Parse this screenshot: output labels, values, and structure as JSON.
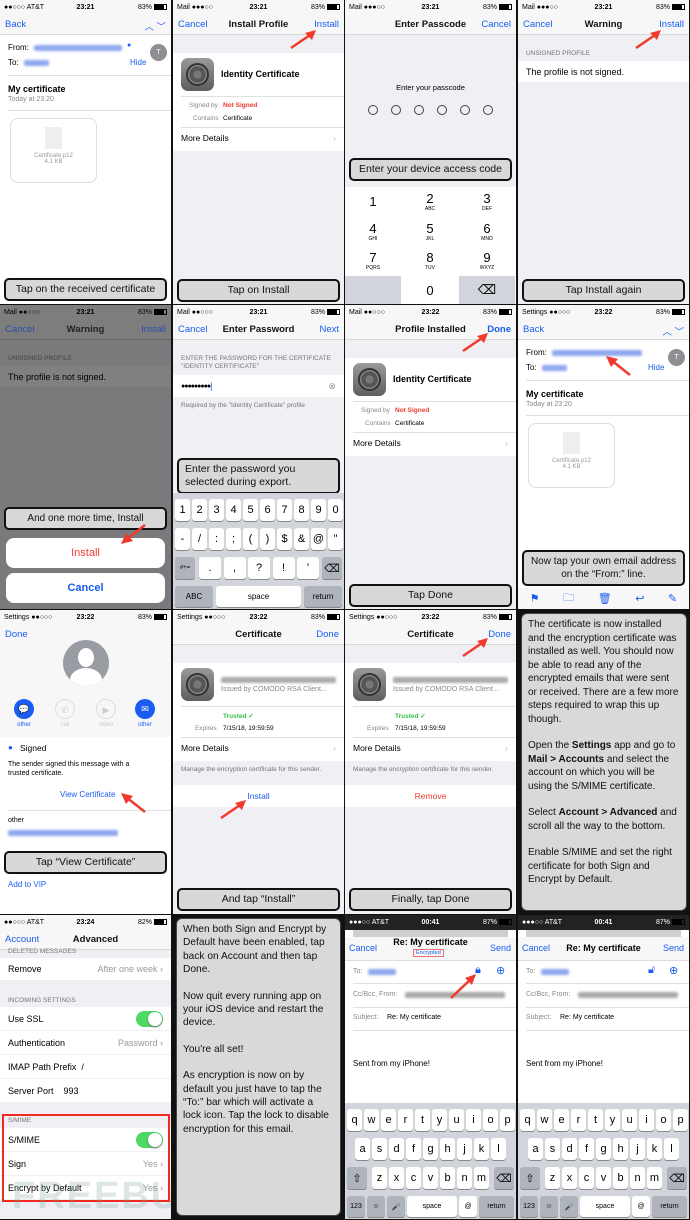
{
  "colors": {
    "accent": "#1a5df0",
    "warning": "#f03a2e",
    "caption_bg": "#d8d8d8",
    "toggle_on": "#4cd964",
    "trusted": "#35c048"
  },
  "watermark": "FREEBUF",
  "status": [
    {
      "left": "●●○○○ AT&T",
      "time": "23:21",
      "battery": "83%"
    },
    {
      "left": "Mail ●●●○○",
      "time": "23:21",
      "battery": "83%"
    },
    {
      "left": "Mail ●●●○○",
      "time": "23:21",
      "battery": "83%"
    },
    {
      "left": "Mail ●●●○○",
      "time": "23:21",
      "battery": "83%"
    },
    {
      "left": "Mail ●●○○○",
      "time": "23:21",
      "battery": "83%"
    },
    {
      "left": "Mail ●●○○○",
      "time": "23:21",
      "battery": "83%"
    },
    {
      "left": "Mail ●●○○○",
      "time": "23:22",
      "battery": "83%"
    },
    {
      "left": "Settings ●●○○○",
      "time": "23:22",
      "battery": "83%"
    },
    {
      "left": "Settings ●●○○○",
      "time": "23:22",
      "battery": "83%"
    },
    {
      "left": "Settings ●●○○○",
      "time": "23:22",
      "battery": "83%"
    },
    {
      "left": "Settings ●●○○○",
      "time": "23:22",
      "battery": "83%"
    },
    null,
    {
      "left": "●●○○○ AT&T",
      "time": "23:24",
      "battery": "82%"
    },
    null,
    {
      "left": "●●●○○ AT&T",
      "time": "00:41",
      "battery": "87%"
    },
    {
      "left": "●●●○○ AT&T",
      "time": "00:41",
      "battery": "87%"
    }
  ],
  "email": {
    "back": "Back",
    "from_label": "From:",
    "to_label": "To:",
    "hide": "Hide",
    "avatar": "T",
    "subject": "My certificate",
    "date": "Today at 23:20",
    "attachment": "Certificate.p12",
    "size": "4.1 KB"
  },
  "profile": {
    "name": "Identity Certificate",
    "signed_by_label": "Signed by",
    "signed_by": "Not Signed",
    "contains_label": "Contains",
    "contains": "Certificate",
    "more": "More Details"
  },
  "p1": {
    "caption": "Tap on the received certificate"
  },
  "p2": {
    "cancel": "Cancel",
    "title": "Install Profile",
    "install": "Install",
    "caption": "Tap on Install"
  },
  "p3": {
    "title": "Enter Passcode",
    "cancel": "Cancel",
    "prompt": "Enter your passcode",
    "caption": "Enter your device access code",
    "keys": [
      [
        "1",
        ""
      ],
      [
        "2",
        "ABC"
      ],
      [
        "3",
        "DEF"
      ],
      [
        "4",
        "GHI"
      ],
      [
        "5",
        "JKL"
      ],
      [
        "6",
        "MNO"
      ],
      [
        "7",
        "PQRS"
      ],
      [
        "8",
        "TUV"
      ],
      [
        "9",
        "WXYZ"
      ],
      [
        "",
        ""
      ],
      [
        "0",
        ""
      ],
      [
        "⌫",
        ""
      ]
    ]
  },
  "warning": {
    "cancel": "Cancel",
    "title": "Warning",
    "install": "Install",
    "section": "UNSIGNED PROFILE",
    "text": "The profile is not signed."
  },
  "p4": {
    "caption": "Tap Install again"
  },
  "p5": {
    "caption": "And one more time, Install",
    "install": "Install",
    "cancel": "Cancel"
  },
  "p6": {
    "cancel": "Cancel",
    "title": "Enter Password",
    "next": "Next",
    "label": "ENTER THE PASSWORD FOR THE CERTIFICATE \"IDENTITY CERTIFICATE\"",
    "value": "●●●●●●●●●",
    "note": "Required by the \"Identity Certificate\" profile",
    "caption": "Enter the password you selected during export.",
    "rows": [
      [
        "1",
        "2",
        "3",
        "4",
        "5",
        "6",
        "7",
        "8",
        "9",
        "0"
      ],
      [
        "-",
        "/",
        ":",
        ";",
        "(",
        ")",
        "$",
        "&",
        "@",
        "\""
      ],
      [
        "#+=",
        ".",
        ",",
        "?",
        "!",
        "'",
        "⌫"
      ],
      [
        "ABC",
        "space",
        "return"
      ]
    ]
  },
  "p7": {
    "title": "Profile Installed",
    "done": "Done",
    "caption": "Tap Done"
  },
  "p8": {
    "caption": "Now tap your own email address on the “From:” line.",
    "toolbar": [
      "flag-icon",
      "folder-icon",
      "trash-icon",
      "reply-icon",
      "compose-icon"
    ]
  },
  "p9": {
    "done": "Done",
    "actions": [
      {
        "label": "other",
        "icon": "message-icon",
        "active": true
      },
      {
        "label": "call",
        "icon": "phone-icon",
        "active": false
      },
      {
        "label": "video",
        "icon": "video-icon",
        "active": false
      },
      {
        "label": "other",
        "icon": "mail-icon",
        "active": true
      }
    ],
    "signed": "Signed",
    "signed_desc": "The sender signed this message with a trusted certificate.",
    "view": "View Certificate",
    "other": "other",
    "caption": "Tap “View Certificate”",
    "vip": "Add to VIP"
  },
  "cert": {
    "title": "Certificate",
    "done": "Done",
    "issuer": "Issued by COMODO RSA Client...",
    "trusted": "Trusted ✓",
    "expires_label": "Expires",
    "expires": "7/15/18, 19:59:59",
    "more": "More Details",
    "manage": "Manage the encryption certificate for this sender."
  },
  "p10": {
    "action": "Install",
    "caption": "And tap “Install”"
  },
  "p11": {
    "action": "Remove",
    "caption": "Finally, tap Done"
  },
  "p12": {
    "paras": [
      "The certificate is now installed and the encryption certificate was installed as well. You should now be able to read any of the encrypted emails that were sent or received. There are a few more steps required to wrap this up though."
    ],
    "p2a": "Open the ",
    "p2b": "Settings",
    "p2c": " app and go to ",
    "p2d": "Mail > Accounts",
    "p2e": " and select the account on which you will be using the S/MIME certificate.",
    "p3a": "Select ",
    "p3b": "Account > Advanced",
    "p3c": " and scroll all the way to the bottom.",
    "p4": "Enable S/MIME and set the right certificate for both Sign and Encrypt by Default."
  },
  "p13": {
    "back": "Account",
    "title": "Advanced",
    "deleted": "DELETED MESSAGES",
    "remove": "Remove",
    "remove_val": "After one week",
    "incoming": "INCOMING SETTINGS",
    "ssl": "Use SSL",
    "auth": "Authentication",
    "auth_val": "Password",
    "imap": "IMAP Path Prefix",
    "imap_val": "/",
    "port": "Server Port",
    "port_val": "993",
    "smime_hdr": "S/MIME",
    "smime": "S/MIME",
    "sign": "Sign",
    "sign_val": "Yes",
    "enc": "Encrypt by Default",
    "enc_val": "Yes"
  },
  "p14": {
    "paras": [
      "When both Sign and Encrypt by Default have been enabled, tap back on Account and then tap Done.",
      "Now quit every running app on your iOS device and restart the device.",
      "You're all set!",
      "As encryption is now on by default you just have to tap the “To:” bar which will activate a lock icon. Tap the lock to disable encryption for this email."
    ]
  },
  "compose": {
    "cancel": "Cancel",
    "title": "Re: My certificate",
    "send": "Send",
    "badge": "Encrypted",
    "to": "To:",
    "cc": "Cc/Bcc, From:",
    "subject_label": "Subject:",
    "subject": "Re: My certificate",
    "body": "Sent from my iPhone!",
    "rows": [
      [
        "q",
        "w",
        "e",
        "r",
        "t",
        "y",
        "u",
        "i",
        "o",
        "p"
      ],
      [
        "a",
        "s",
        "d",
        "f",
        "g",
        "h",
        "j",
        "k",
        "l"
      ],
      [
        "⇧",
        "z",
        "x",
        "c",
        "v",
        "b",
        "n",
        "m",
        "⌫"
      ],
      [
        "123",
        "☺",
        "🎤",
        "space",
        "@",
        ".",
        "return"
      ]
    ]
  }
}
